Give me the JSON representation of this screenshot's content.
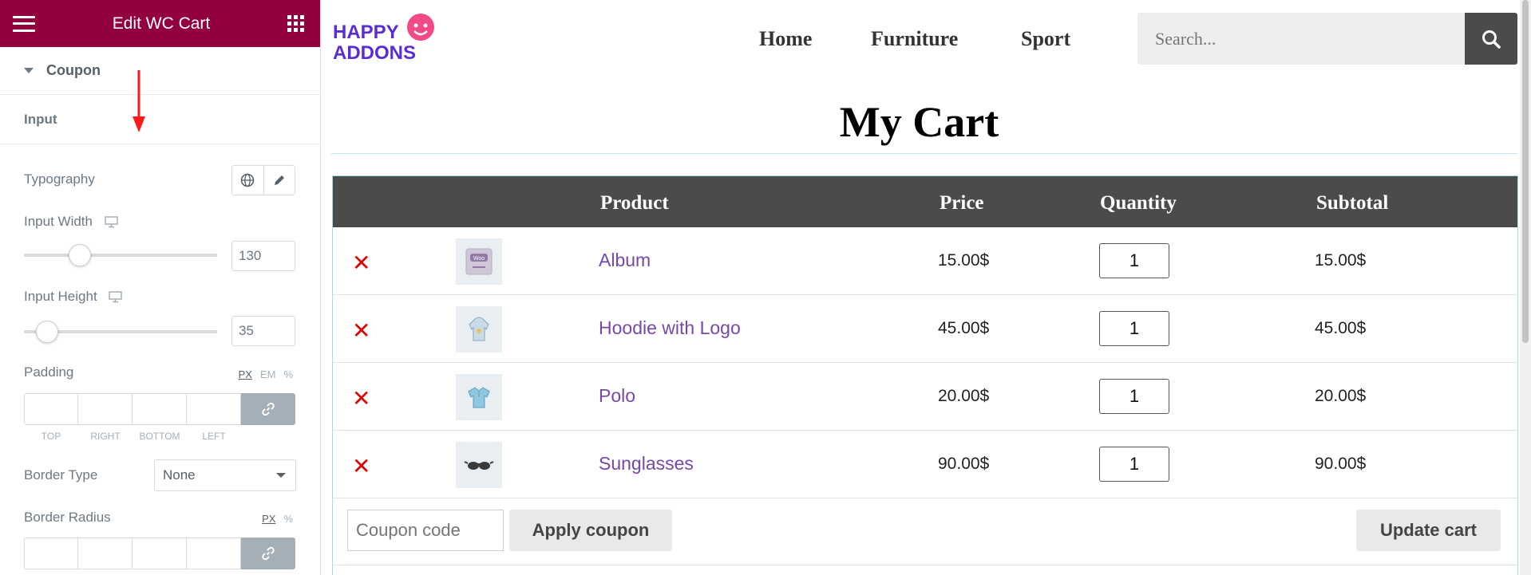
{
  "panel": {
    "title": "Edit WC Cart",
    "section": "Coupon",
    "subsection": "Input",
    "typography_label": "Typography",
    "input_width_label": "Input Width",
    "input_width_value": "130",
    "input_width_fraction": 0.26,
    "input_height_label": "Input Height",
    "input_height_value": "35",
    "input_height_fraction": 0.07,
    "padding_label": "Padding",
    "padding_units": [
      "PX",
      "EM",
      "%"
    ],
    "dimension_labels": [
      "TOP",
      "RIGHT",
      "BOTTOM",
      "LEFT"
    ],
    "border_type_label": "Border Type",
    "border_type_value": "None",
    "border_radius_label": "Border Radius",
    "border_radius_units": [
      "PX",
      "%"
    ],
    "colors": {
      "header": "#93003f",
      "link_button": "#a4afb7"
    }
  },
  "site": {
    "logo_line1": "HAPPY",
    "logo_line2": "ADDONS",
    "nav": [
      "Home",
      "Furniture",
      "Sport"
    ],
    "search_placeholder": "Search..."
  },
  "cart": {
    "title": "My Cart",
    "headers": [
      "Product",
      "Price",
      "Quantity",
      "Subtotal"
    ],
    "rows": [
      {
        "product": "Album",
        "price": "15.00$",
        "qty": "1",
        "subtotal": "15.00$",
        "thumb": "album-icon"
      },
      {
        "product": "Hoodie with Logo",
        "price": "45.00$",
        "qty": "1",
        "subtotal": "45.00$",
        "thumb": "hoodie-icon"
      },
      {
        "product": "Polo",
        "price": "20.00$",
        "qty": "1",
        "subtotal": "20.00$",
        "thumb": "polo-icon"
      },
      {
        "product": "Sunglasses",
        "price": "90.00$",
        "qty": "1",
        "subtotal": "90.00$",
        "thumb": "sunglasses-icon"
      }
    ],
    "remove_glyph": "✕",
    "coupon_placeholder": "Coupon code",
    "apply_coupon": "Apply coupon",
    "update_cart": "Update cart"
  }
}
